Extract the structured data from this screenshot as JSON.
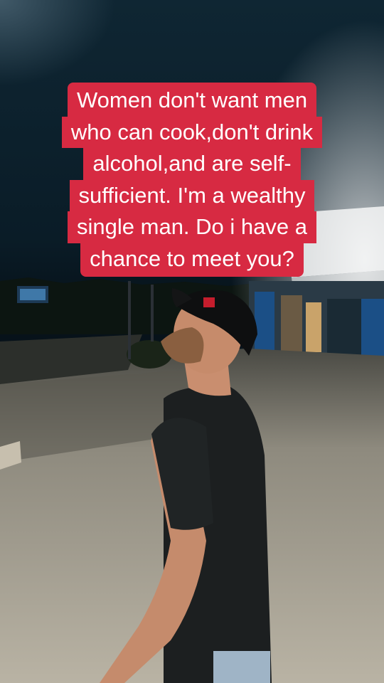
{
  "caption": {
    "lines": [
      "Women don't want men",
      "who can cook,don't drink",
      "alcohol,and are self-",
      "sufficient. I'm a wealthy",
      "single man. Do i have a",
      "chance to meet you?"
    ],
    "background": "#d72a42",
    "text_color": "#ffffff"
  }
}
